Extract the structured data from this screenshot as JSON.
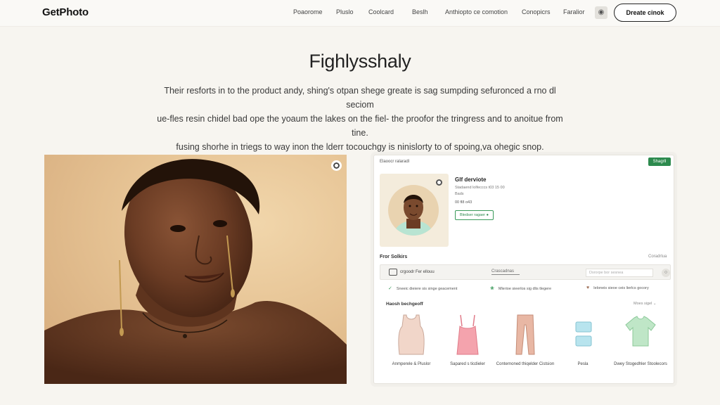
{
  "nav": {
    "logo": "GetPhoto",
    "links": [
      "Poaorome",
      "Pluslo",
      "Coolcard",
      "Beslh",
      "Anthiopto ce comotion",
      "Conopicrs",
      "Faralior"
    ],
    "icon": "user-icon",
    "cta": "Dreate cinok"
  },
  "hero": {
    "title": "Fighlysshaly",
    "line1": "Their resforts in to the product andy, shing's otpan shege greate is sag sumpding sefuronced a rno dl seciom",
    "line2": "ue-fles resin chidel bad ope the yoaum the lakes on the fiel- the proofor the tringress and to anoitue from tine.",
    "line3": "fusing shorhe in triegs to way inon the lderr tocouchgy is ninislorty to of spoing,va ohegic snop."
  },
  "photo": {
    "alt_icon": "circle-dot-icon"
  },
  "panel": {
    "crumb": "Elaoocr ralaradl",
    "green_btn": "Shagrll",
    "profile": {
      "name": "Glf derviote",
      "meta1": "Stadaend lolfecccs t03 15 00",
      "meta2": "Bads",
      "meta3": "00 fl8 o43",
      "chip": "Bledser ragaer ●"
    },
    "section_title": "Fror Solkirs",
    "section_right": "Coradrlua",
    "bar": {
      "label": "crgoodr Fer ellouu",
      "tab": "Crascadnas",
      "search": "Dsrorpe bor sesnea",
      "btn": "○"
    },
    "features": [
      {
        "icon": "check-icon",
        "color": "#3a9a5a",
        "text": "Sneeic dieiere sis singe geacement"
      },
      {
        "icon": "leaf-icon",
        "color": "#3a9a5a",
        "text": "Mlerioe sieerlos sig dlis tlegere"
      },
      {
        "icon": "heart-icon",
        "color": "#a0725a",
        "text": "Ieloneis sieoe ceis lierlcs gocory"
      }
    ],
    "products_title": "Haosh bechgeoff",
    "products_right": "Moes sigel",
    "products": [
      {
        "label": "Anmperele & Pluslor",
        "color": "#f1d6c9"
      },
      {
        "label": "Sapared s ticdieler",
        "color": "#f4a3ad"
      },
      {
        "label": "Conternoned thiqelder Cistsion",
        "color": "#e8b7a4"
      },
      {
        "label": "Pesla",
        "color": "#b8e4ee"
      },
      {
        "label": "Dwey Stogedhler Stoolecors",
        "color": "#bfe6c7"
      }
    ]
  }
}
